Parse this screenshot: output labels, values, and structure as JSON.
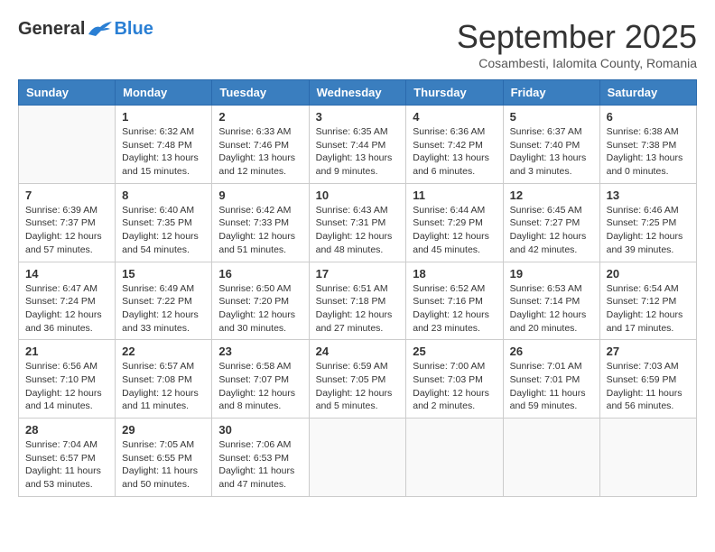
{
  "header": {
    "logo": {
      "general": "General",
      "blue": "Blue"
    },
    "title": "September 2025",
    "subtitle": "Cosambesti, Ialomita County, Romania"
  },
  "weekdays": [
    "Sunday",
    "Monday",
    "Tuesday",
    "Wednesday",
    "Thursday",
    "Friday",
    "Saturday"
  ],
  "weeks": [
    [
      {
        "day": "",
        "sunrise": "",
        "sunset": "",
        "daylight": ""
      },
      {
        "day": "1",
        "sunrise": "Sunrise: 6:32 AM",
        "sunset": "Sunset: 7:48 PM",
        "daylight": "Daylight: 13 hours and 15 minutes."
      },
      {
        "day": "2",
        "sunrise": "Sunrise: 6:33 AM",
        "sunset": "Sunset: 7:46 PM",
        "daylight": "Daylight: 13 hours and 12 minutes."
      },
      {
        "day": "3",
        "sunrise": "Sunrise: 6:35 AM",
        "sunset": "Sunset: 7:44 PM",
        "daylight": "Daylight: 13 hours and 9 minutes."
      },
      {
        "day": "4",
        "sunrise": "Sunrise: 6:36 AM",
        "sunset": "Sunset: 7:42 PM",
        "daylight": "Daylight: 13 hours and 6 minutes."
      },
      {
        "day": "5",
        "sunrise": "Sunrise: 6:37 AM",
        "sunset": "Sunset: 7:40 PM",
        "daylight": "Daylight: 13 hours and 3 minutes."
      },
      {
        "day": "6",
        "sunrise": "Sunrise: 6:38 AM",
        "sunset": "Sunset: 7:38 PM",
        "daylight": "Daylight: 13 hours and 0 minutes."
      }
    ],
    [
      {
        "day": "7",
        "sunrise": "Sunrise: 6:39 AM",
        "sunset": "Sunset: 7:37 PM",
        "daylight": "Daylight: 12 hours and 57 minutes."
      },
      {
        "day": "8",
        "sunrise": "Sunrise: 6:40 AM",
        "sunset": "Sunset: 7:35 PM",
        "daylight": "Daylight: 12 hours and 54 minutes."
      },
      {
        "day": "9",
        "sunrise": "Sunrise: 6:42 AM",
        "sunset": "Sunset: 7:33 PM",
        "daylight": "Daylight: 12 hours and 51 minutes."
      },
      {
        "day": "10",
        "sunrise": "Sunrise: 6:43 AM",
        "sunset": "Sunset: 7:31 PM",
        "daylight": "Daylight: 12 hours and 48 minutes."
      },
      {
        "day": "11",
        "sunrise": "Sunrise: 6:44 AM",
        "sunset": "Sunset: 7:29 PM",
        "daylight": "Daylight: 12 hours and 45 minutes."
      },
      {
        "day": "12",
        "sunrise": "Sunrise: 6:45 AM",
        "sunset": "Sunset: 7:27 PM",
        "daylight": "Daylight: 12 hours and 42 minutes."
      },
      {
        "day": "13",
        "sunrise": "Sunrise: 6:46 AM",
        "sunset": "Sunset: 7:25 PM",
        "daylight": "Daylight: 12 hours and 39 minutes."
      }
    ],
    [
      {
        "day": "14",
        "sunrise": "Sunrise: 6:47 AM",
        "sunset": "Sunset: 7:24 PM",
        "daylight": "Daylight: 12 hours and 36 minutes."
      },
      {
        "day": "15",
        "sunrise": "Sunrise: 6:49 AM",
        "sunset": "Sunset: 7:22 PM",
        "daylight": "Daylight: 12 hours and 33 minutes."
      },
      {
        "day": "16",
        "sunrise": "Sunrise: 6:50 AM",
        "sunset": "Sunset: 7:20 PM",
        "daylight": "Daylight: 12 hours and 30 minutes."
      },
      {
        "day": "17",
        "sunrise": "Sunrise: 6:51 AM",
        "sunset": "Sunset: 7:18 PM",
        "daylight": "Daylight: 12 hours and 27 minutes."
      },
      {
        "day": "18",
        "sunrise": "Sunrise: 6:52 AM",
        "sunset": "Sunset: 7:16 PM",
        "daylight": "Daylight: 12 hours and 23 minutes."
      },
      {
        "day": "19",
        "sunrise": "Sunrise: 6:53 AM",
        "sunset": "Sunset: 7:14 PM",
        "daylight": "Daylight: 12 hours and 20 minutes."
      },
      {
        "day": "20",
        "sunrise": "Sunrise: 6:54 AM",
        "sunset": "Sunset: 7:12 PM",
        "daylight": "Daylight: 12 hours and 17 minutes."
      }
    ],
    [
      {
        "day": "21",
        "sunrise": "Sunrise: 6:56 AM",
        "sunset": "Sunset: 7:10 PM",
        "daylight": "Daylight: 12 hours and 14 minutes."
      },
      {
        "day": "22",
        "sunrise": "Sunrise: 6:57 AM",
        "sunset": "Sunset: 7:08 PM",
        "daylight": "Daylight: 12 hours and 11 minutes."
      },
      {
        "day": "23",
        "sunrise": "Sunrise: 6:58 AM",
        "sunset": "Sunset: 7:07 PM",
        "daylight": "Daylight: 12 hours and 8 minutes."
      },
      {
        "day": "24",
        "sunrise": "Sunrise: 6:59 AM",
        "sunset": "Sunset: 7:05 PM",
        "daylight": "Daylight: 12 hours and 5 minutes."
      },
      {
        "day": "25",
        "sunrise": "Sunrise: 7:00 AM",
        "sunset": "Sunset: 7:03 PM",
        "daylight": "Daylight: 12 hours and 2 minutes."
      },
      {
        "day": "26",
        "sunrise": "Sunrise: 7:01 AM",
        "sunset": "Sunset: 7:01 PM",
        "daylight": "Daylight: 11 hours and 59 minutes."
      },
      {
        "day": "27",
        "sunrise": "Sunrise: 7:03 AM",
        "sunset": "Sunset: 6:59 PM",
        "daylight": "Daylight: 11 hours and 56 minutes."
      }
    ],
    [
      {
        "day": "28",
        "sunrise": "Sunrise: 7:04 AM",
        "sunset": "Sunset: 6:57 PM",
        "daylight": "Daylight: 11 hours and 53 minutes."
      },
      {
        "day": "29",
        "sunrise": "Sunrise: 7:05 AM",
        "sunset": "Sunset: 6:55 PM",
        "daylight": "Daylight: 11 hours and 50 minutes."
      },
      {
        "day": "30",
        "sunrise": "Sunrise: 7:06 AM",
        "sunset": "Sunset: 6:53 PM",
        "daylight": "Daylight: 11 hours and 47 minutes."
      },
      {
        "day": "",
        "sunrise": "",
        "sunset": "",
        "daylight": ""
      },
      {
        "day": "",
        "sunrise": "",
        "sunset": "",
        "daylight": ""
      },
      {
        "day": "",
        "sunrise": "",
        "sunset": "",
        "daylight": ""
      },
      {
        "day": "",
        "sunrise": "",
        "sunset": "",
        "daylight": ""
      }
    ]
  ]
}
